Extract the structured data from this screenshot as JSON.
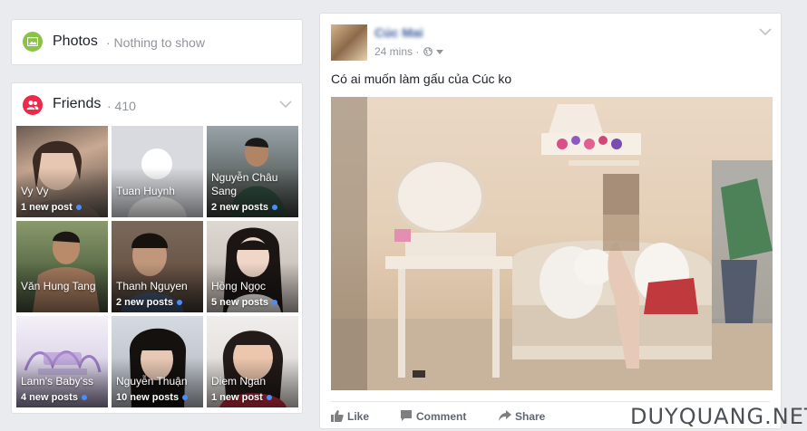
{
  "photos": {
    "title": "Photos",
    "empty_text": "· Nothing to show"
  },
  "friends": {
    "title": "Friends",
    "count": "· 410",
    "tiles": [
      {
        "name": "Vy Vy",
        "posts": "1 new post"
      },
      {
        "name": "Tuan Huynh",
        "posts": ""
      },
      {
        "name": "Nguyễn Châu Sang",
        "posts": "2 new posts"
      },
      {
        "name": "Văn Hung Tang",
        "posts": ""
      },
      {
        "name": "Thanh Nguyen",
        "posts": "2 new posts"
      },
      {
        "name": "Hồng Ngọc",
        "posts": "5 new posts"
      },
      {
        "name": "Lann's Baby'ss",
        "posts": "4 new posts"
      },
      {
        "name": "Nguyễn Thuận",
        "posts": "10 new posts"
      },
      {
        "name": "Diem Ngan",
        "posts": "1 new post"
      }
    ]
  },
  "post": {
    "author": "Cúc Mai",
    "time": "24 mins ·",
    "text": "Có ai muốn làm gấu của Cúc ko",
    "actions": {
      "like": "Like",
      "comment": "Comment",
      "share": "Share"
    }
  },
  "watermark": "DUYQUANG.NET",
  "colors": {
    "link": "#365899",
    "friends_icon": "#f02849",
    "photos_icon": "#8bc34a",
    "page_bg": "#e9ebee"
  }
}
